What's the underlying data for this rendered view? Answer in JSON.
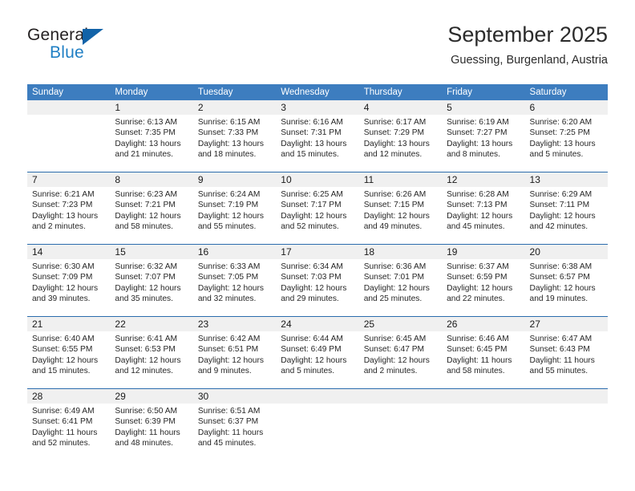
{
  "brand": {
    "name_top": "General",
    "name_bottom": "Blue",
    "triangle_color": "#1263a8",
    "blue_color": "#1f7fc4"
  },
  "header": {
    "month_title": "September 2025",
    "location": "Guessing, Burgenland, Austria"
  },
  "theme": {
    "header_bg": "#3d7dbf",
    "header_text": "#ffffff",
    "row_divider": "#2b6cad",
    "day_number_bg": "#f0f0f0",
    "cell_bg": "#ffffff"
  },
  "weekdays": [
    "Sunday",
    "Monday",
    "Tuesday",
    "Wednesday",
    "Thursday",
    "Friday",
    "Saturday"
  ],
  "weeks": [
    [
      {
        "day": "",
        "sunrise": "",
        "sunset": "",
        "daylight_1": "",
        "daylight_2": ""
      },
      {
        "day": "1",
        "sunrise": "Sunrise: 6:13 AM",
        "sunset": "Sunset: 7:35 PM",
        "daylight_1": "Daylight: 13 hours",
        "daylight_2": "and 21 minutes."
      },
      {
        "day": "2",
        "sunrise": "Sunrise: 6:15 AM",
        "sunset": "Sunset: 7:33 PM",
        "daylight_1": "Daylight: 13 hours",
        "daylight_2": "and 18 minutes."
      },
      {
        "day": "3",
        "sunrise": "Sunrise: 6:16 AM",
        "sunset": "Sunset: 7:31 PM",
        "daylight_1": "Daylight: 13 hours",
        "daylight_2": "and 15 minutes."
      },
      {
        "day": "4",
        "sunrise": "Sunrise: 6:17 AM",
        "sunset": "Sunset: 7:29 PM",
        "daylight_1": "Daylight: 13 hours",
        "daylight_2": "and 12 minutes."
      },
      {
        "day": "5",
        "sunrise": "Sunrise: 6:19 AM",
        "sunset": "Sunset: 7:27 PM",
        "daylight_1": "Daylight: 13 hours",
        "daylight_2": "and 8 minutes."
      },
      {
        "day": "6",
        "sunrise": "Sunrise: 6:20 AM",
        "sunset": "Sunset: 7:25 PM",
        "daylight_1": "Daylight: 13 hours",
        "daylight_2": "and 5 minutes."
      }
    ],
    [
      {
        "day": "7",
        "sunrise": "Sunrise: 6:21 AM",
        "sunset": "Sunset: 7:23 PM",
        "daylight_1": "Daylight: 13 hours",
        "daylight_2": "and 2 minutes."
      },
      {
        "day": "8",
        "sunrise": "Sunrise: 6:23 AM",
        "sunset": "Sunset: 7:21 PM",
        "daylight_1": "Daylight: 12 hours",
        "daylight_2": "and 58 minutes."
      },
      {
        "day": "9",
        "sunrise": "Sunrise: 6:24 AM",
        "sunset": "Sunset: 7:19 PM",
        "daylight_1": "Daylight: 12 hours",
        "daylight_2": "and 55 minutes."
      },
      {
        "day": "10",
        "sunrise": "Sunrise: 6:25 AM",
        "sunset": "Sunset: 7:17 PM",
        "daylight_1": "Daylight: 12 hours",
        "daylight_2": "and 52 minutes."
      },
      {
        "day": "11",
        "sunrise": "Sunrise: 6:26 AM",
        "sunset": "Sunset: 7:15 PM",
        "daylight_1": "Daylight: 12 hours",
        "daylight_2": "and 49 minutes."
      },
      {
        "day": "12",
        "sunrise": "Sunrise: 6:28 AM",
        "sunset": "Sunset: 7:13 PM",
        "daylight_1": "Daylight: 12 hours",
        "daylight_2": "and 45 minutes."
      },
      {
        "day": "13",
        "sunrise": "Sunrise: 6:29 AM",
        "sunset": "Sunset: 7:11 PM",
        "daylight_1": "Daylight: 12 hours",
        "daylight_2": "and 42 minutes."
      }
    ],
    [
      {
        "day": "14",
        "sunrise": "Sunrise: 6:30 AM",
        "sunset": "Sunset: 7:09 PM",
        "daylight_1": "Daylight: 12 hours",
        "daylight_2": "and 39 minutes."
      },
      {
        "day": "15",
        "sunrise": "Sunrise: 6:32 AM",
        "sunset": "Sunset: 7:07 PM",
        "daylight_1": "Daylight: 12 hours",
        "daylight_2": "and 35 minutes."
      },
      {
        "day": "16",
        "sunrise": "Sunrise: 6:33 AM",
        "sunset": "Sunset: 7:05 PM",
        "daylight_1": "Daylight: 12 hours",
        "daylight_2": "and 32 minutes."
      },
      {
        "day": "17",
        "sunrise": "Sunrise: 6:34 AM",
        "sunset": "Sunset: 7:03 PM",
        "daylight_1": "Daylight: 12 hours",
        "daylight_2": "and 29 minutes."
      },
      {
        "day": "18",
        "sunrise": "Sunrise: 6:36 AM",
        "sunset": "Sunset: 7:01 PM",
        "daylight_1": "Daylight: 12 hours",
        "daylight_2": "and 25 minutes."
      },
      {
        "day": "19",
        "sunrise": "Sunrise: 6:37 AM",
        "sunset": "Sunset: 6:59 PM",
        "daylight_1": "Daylight: 12 hours",
        "daylight_2": "and 22 minutes."
      },
      {
        "day": "20",
        "sunrise": "Sunrise: 6:38 AM",
        "sunset": "Sunset: 6:57 PM",
        "daylight_1": "Daylight: 12 hours",
        "daylight_2": "and 19 minutes."
      }
    ],
    [
      {
        "day": "21",
        "sunrise": "Sunrise: 6:40 AM",
        "sunset": "Sunset: 6:55 PM",
        "daylight_1": "Daylight: 12 hours",
        "daylight_2": "and 15 minutes."
      },
      {
        "day": "22",
        "sunrise": "Sunrise: 6:41 AM",
        "sunset": "Sunset: 6:53 PM",
        "daylight_1": "Daylight: 12 hours",
        "daylight_2": "and 12 minutes."
      },
      {
        "day": "23",
        "sunrise": "Sunrise: 6:42 AM",
        "sunset": "Sunset: 6:51 PM",
        "daylight_1": "Daylight: 12 hours",
        "daylight_2": "and 9 minutes."
      },
      {
        "day": "24",
        "sunrise": "Sunrise: 6:44 AM",
        "sunset": "Sunset: 6:49 PM",
        "daylight_1": "Daylight: 12 hours",
        "daylight_2": "and 5 minutes."
      },
      {
        "day": "25",
        "sunrise": "Sunrise: 6:45 AM",
        "sunset": "Sunset: 6:47 PM",
        "daylight_1": "Daylight: 12 hours",
        "daylight_2": "and 2 minutes."
      },
      {
        "day": "26",
        "sunrise": "Sunrise: 6:46 AM",
        "sunset": "Sunset: 6:45 PM",
        "daylight_1": "Daylight: 11 hours",
        "daylight_2": "and 58 minutes."
      },
      {
        "day": "27",
        "sunrise": "Sunrise: 6:47 AM",
        "sunset": "Sunset: 6:43 PM",
        "daylight_1": "Daylight: 11 hours",
        "daylight_2": "and 55 minutes."
      }
    ],
    [
      {
        "day": "28",
        "sunrise": "Sunrise: 6:49 AM",
        "sunset": "Sunset: 6:41 PM",
        "daylight_1": "Daylight: 11 hours",
        "daylight_2": "and 52 minutes."
      },
      {
        "day": "29",
        "sunrise": "Sunrise: 6:50 AM",
        "sunset": "Sunset: 6:39 PM",
        "daylight_1": "Daylight: 11 hours",
        "daylight_2": "and 48 minutes."
      },
      {
        "day": "30",
        "sunrise": "Sunrise: 6:51 AM",
        "sunset": "Sunset: 6:37 PM",
        "daylight_1": "Daylight: 11 hours",
        "daylight_2": "and 45 minutes."
      },
      {
        "day": "",
        "sunrise": "",
        "sunset": "",
        "daylight_1": "",
        "daylight_2": ""
      },
      {
        "day": "",
        "sunrise": "",
        "sunset": "",
        "daylight_1": "",
        "daylight_2": ""
      },
      {
        "day": "",
        "sunrise": "",
        "sunset": "",
        "daylight_1": "",
        "daylight_2": ""
      },
      {
        "day": "",
        "sunrise": "",
        "sunset": "",
        "daylight_1": "",
        "daylight_2": ""
      }
    ]
  ]
}
